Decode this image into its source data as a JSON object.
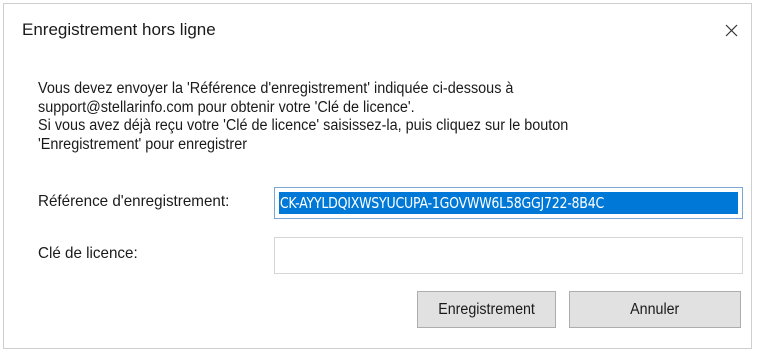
{
  "dialog": {
    "title": "Enregistrement hors ligne",
    "close_glyph": "close-icon",
    "message_lines": [
      "Vous devez envoyer la 'Référence d'enregistrement' indiquée ci-dessous à",
      "support@stellarinfo.com pour obtenir votre 'Clé de licence'.",
      "Si vous avez déjà reçu votre 'Clé de licence' saisissez-la, puis cliquez sur le bouton",
      "'Enregistrement' pour enregistrer"
    ],
    "reference_label": "Référence d'enregistrement:",
    "reference_value": "CK-AYYLDQIXWSYUCUPA-1GOVWW6L58GGJ722-8B4C",
    "license_label": "Clé de licence:",
    "license_value": "",
    "register_button": "Enregistrement",
    "cancel_button": "Annuler"
  },
  "colors": {
    "selection": "#0078d7",
    "button_bg": "#e1e1e1",
    "button_border": "#adadad"
  }
}
